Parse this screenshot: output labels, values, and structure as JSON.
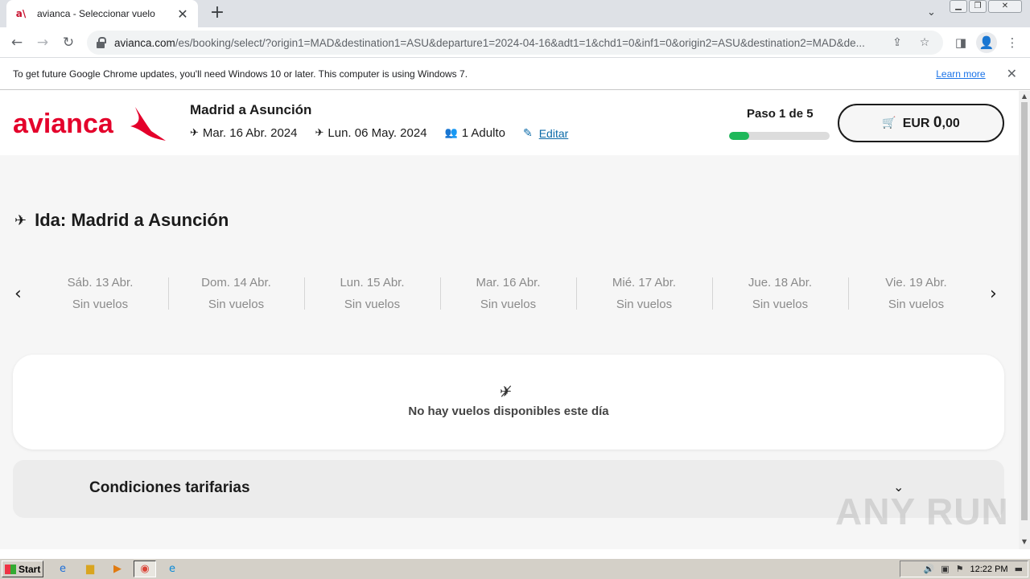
{
  "browser": {
    "tab_title": "avianca - Seleccionar vuelo",
    "tab_favicon": "a\\",
    "new_tab": "+",
    "url_host": "avianca.com",
    "url_path": "/es/booking/select/?origin1=MAD&destination1=ASU&departure1=2024-04-16&adt1=1&chd1=0&inf1=0&origin2=ASU&destination2=MAD&de...",
    "icons": [
      "back-icon",
      "forward-icon",
      "reload-icon",
      "lock-icon",
      "share-icon",
      "star-icon",
      "sidepanel-icon",
      "profile-icon",
      "menu-icon"
    ]
  },
  "infobar": {
    "message": "To get future Google Chrome updates, you'll need Windows 10 or later. This computer is using Windows 7.",
    "link": "Learn more"
  },
  "header": {
    "brand": "avianca",
    "route": "Madrid a Asunción",
    "departure_date": "Mar. 16 Abr. 2024",
    "return_date": "Lun. 06 May. 2024",
    "passengers": "1 Adulto",
    "edit_label": "Editar",
    "step": "Paso 1 de 5",
    "progress_fraction": 0.2,
    "cart_currency": "EUR",
    "cart_amount_int": "0",
    "cart_amount_dec": ",00",
    "colors": {
      "brand_red": "#e4002b",
      "progress_green": "#1fb85a",
      "link_blue": "#0b6aa8"
    }
  },
  "section": {
    "title": "Ida: Madrid a Asunción"
  },
  "dates": [
    {
      "day": "Sáb. 13 Abr.",
      "status": "Sin vuelos"
    },
    {
      "day": "Dom. 14 Abr.",
      "status": "Sin vuelos"
    },
    {
      "day": "Lun. 15 Abr.",
      "status": "Sin vuelos"
    },
    {
      "day": "Mar. 16 Abr.",
      "status": "Sin vuelos"
    },
    {
      "day": "Mié. 17 Abr.",
      "status": "Sin vuelos"
    },
    {
      "day": "Jue. 18 Abr.",
      "status": "Sin vuelos"
    },
    {
      "day": "Vie. 19 Abr.",
      "status": "Sin vuelos"
    }
  ],
  "empty_state": {
    "message": "No hay vuelos disponibles este día"
  },
  "conditions": {
    "title": "Condiciones tarifarias"
  },
  "watermark": "ANY RUN",
  "taskbar": {
    "start": "Start",
    "time": "12:22 PM"
  }
}
